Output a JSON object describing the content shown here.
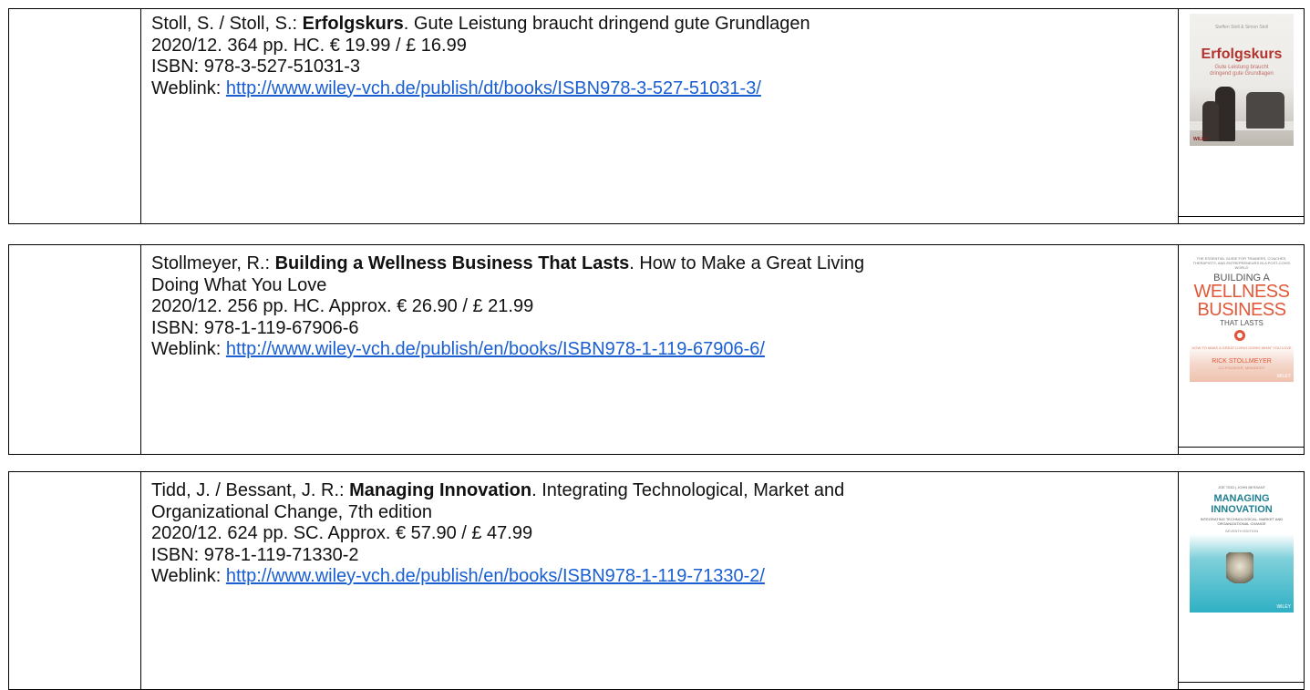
{
  "entries": [
    {
      "authors": "Stoll, S. / Stoll, S.: ",
      "title": "Erfolgskurs",
      "subtitle_line1": ". Gute Leistung braucht dringend gute Grundlagen",
      "subtitle_line2": "",
      "pub_info": "2020/12. 364 pp. HC. € 19.99 / £ 16.99",
      "isbn": "ISBN: 978-3-527-51031-3",
      "weblink_label": "Weblink: ",
      "weblink_url": "http://www.wiley-vch.de/publish/dt/books/ISBN978-3-527-51031-3/",
      "cover": {
        "authors": "Steffen Stoll & Simon Stoll",
        "title": "Erfolgskurs",
        "subtitle_line1": "Gute Leistung braucht",
        "subtitle_line2": "dringend gute Grundlagen",
        "publisher": "WILEY",
        "accent_color": "#b3332f"
      }
    },
    {
      "authors": "Stollmeyer, R.: ",
      "title": "Building a Wellness Business That Lasts",
      "subtitle_line1": ". How to Make a Great Living",
      "subtitle_line2": "Doing What You Love",
      "pub_info": "2020/12. 256 pp. HC. Approx. € 26.90 / £ 21.99",
      "isbn": "ISBN: 978-1-119-67906-6",
      "weblink_label": "Weblink: ",
      "weblink_url": "http://www.wiley-vch.de/publish/en/books/ISBN978-1-119-67906-6/",
      "cover": {
        "tagline": "THE ESSENTIAL GUIDE FOR TRAINERS, COACHES, THERAPISTS, AND ENTREPRENEURS IN A POST-COVID WORLD",
        "title_line1": "BUILDING A",
        "title_line2": "WELLNESS",
        "title_line3": "BUSINESS",
        "title_line4": "THAT LASTS",
        "subtitle": "HOW TO MAKE A GREAT LIVING DOING WHAT YOU LOVE",
        "author": "RICK STOLLMEYER",
        "author_note": "CO-FOUNDER, MINDBODY",
        "publisher": "WILEY",
        "accent_color": "#e05a3a"
      }
    },
    {
      "authors": "Tidd, J. / Bessant, J. R.: ",
      "title": "Managing Innovation",
      "subtitle_line1": ". Integrating Technological, Market and",
      "subtitle_line2": "Organizational Change, 7th edition",
      "pub_info": "2020/12. 624 pp. SC. Approx. € 57.90 / £ 47.99",
      "isbn": "ISBN: 978-1-119-71330-2",
      "weblink_label": "Weblink: ",
      "weblink_url": "http://www.wiley-vch.de/publish/en/books/ISBN978-1-119-71330-2/",
      "cover": {
        "authors": "JOE TIDD | JOHN BESSANT",
        "title_line1": "MANAGING",
        "title_line2": "INNOVATION",
        "subtitle": "INTEGRATING TECHNOLOGICAL, MARKET AND ORGANIZATIONAL CHANGE",
        "edition": "SEVENTH EDITION",
        "publisher": "WILEY",
        "accent_color": "#1f7f90"
      }
    }
  ]
}
